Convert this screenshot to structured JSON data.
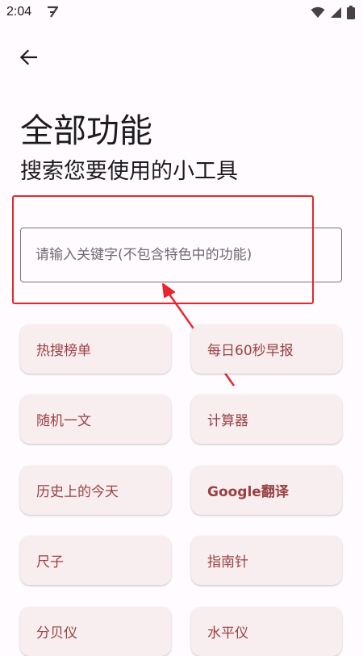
{
  "status_bar": {
    "time": "2:04",
    "notification_icon": "app-notification-icon",
    "wifi_icon": "wifi-icon",
    "signal_icon": "signal-icon",
    "battery_icon": "battery-icon"
  },
  "top_bar": {
    "back_icon": "back-arrow-icon"
  },
  "header": {
    "title": "全部功能",
    "subtitle": "搜索您要使用的小工具"
  },
  "search": {
    "placeholder": "请输入关键字(不包含特色中的功能)",
    "value": ""
  },
  "annotation": {
    "color": "#E8262D"
  },
  "tools": [
    {
      "label": "热搜榜单"
    },
    {
      "label": "每日60秒早报"
    },
    {
      "label": "随机一文"
    },
    {
      "label": "计算器"
    },
    {
      "label": "历史上的今天"
    },
    {
      "label": "Google翻译"
    },
    {
      "label": "尺子"
    },
    {
      "label": "指南针"
    },
    {
      "label": "分贝仪"
    },
    {
      "label": "水平仪"
    }
  ],
  "colors": {
    "background": "#FFFBFE",
    "card_background": "#F8EEEF",
    "card_text": "#9A4044",
    "outline": "#79747E"
  }
}
